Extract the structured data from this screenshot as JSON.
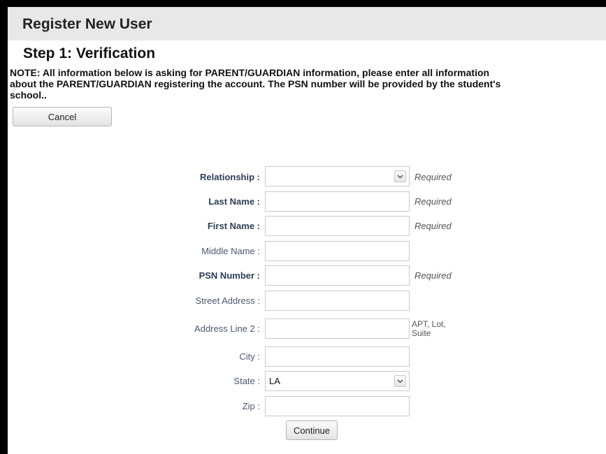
{
  "header": {
    "title": "Register New User"
  },
  "step": {
    "title": "Step 1: Verification"
  },
  "note": "NOTE: All information below is asking for PARENT/GUARDIAN information, please enter all information\nabout the PARENT/GUARDIAN registering the account. The PSN number will be provided by the student's\nschool..",
  "buttons": {
    "cancel": "Cancel",
    "continue": "Continue"
  },
  "form": {
    "relationship": {
      "label": "Relationship :",
      "value": "",
      "hint": "Required"
    },
    "last_name": {
      "label": "Last Name :",
      "value": "",
      "hint": "Required"
    },
    "first_name": {
      "label": "First Name :",
      "value": "",
      "hint": "Required"
    },
    "middle_name": {
      "label": "Middle Name :",
      "value": ""
    },
    "psn_number": {
      "label": "PSN Number :",
      "value": "",
      "hint": "Required"
    },
    "street_address": {
      "label": "Street Address :",
      "value": ""
    },
    "address_line_2": {
      "label": "Address Line 2 :",
      "value": "",
      "hint": "APT, Lot, Suite"
    },
    "city": {
      "label": "City :",
      "value": ""
    },
    "state": {
      "label": "State :",
      "value": "LA"
    },
    "zip": {
      "label": "Zip :",
      "value": ""
    }
  },
  "icons": {
    "select_arrow": "chevron-down-icon"
  }
}
